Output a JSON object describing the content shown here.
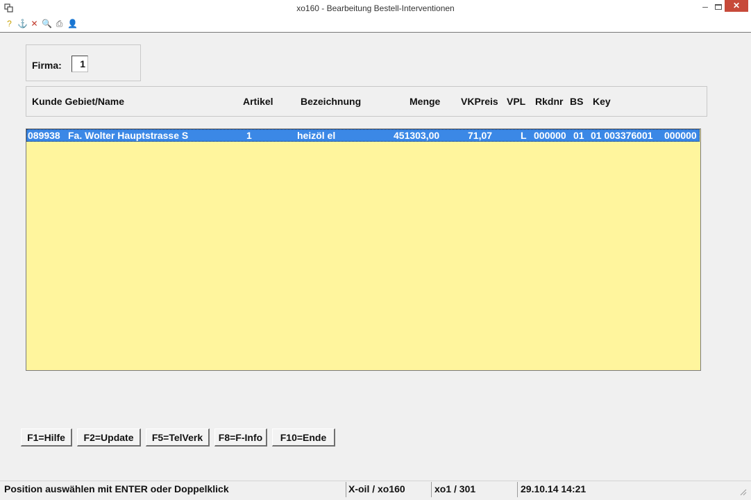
{
  "window": {
    "title": "xo160 - Bearbeitung Bestell-Interventionen",
    "min_glyph": "–",
    "close_glyph": "✕"
  },
  "toolbar": {
    "icons": [
      {
        "name": "help-icon",
        "glyph": "?",
        "color": "#c9a200"
      },
      {
        "name": "anchor-icon",
        "glyph": "⚓",
        "color": "#2a6fcf"
      },
      {
        "name": "delete-icon",
        "glyph": "✕",
        "color": "#c0392b"
      },
      {
        "name": "search-icon",
        "glyph": "🔍",
        "color": "#666666"
      },
      {
        "name": "print-icon",
        "glyph": "⎙",
        "color": "#555555"
      },
      {
        "name": "user-icon",
        "glyph": "👤",
        "color": "#b45a1f"
      }
    ]
  },
  "firma": {
    "label": "Firma:",
    "value": "1"
  },
  "list_headers": {
    "kunde": "Kunde Gebiet/Name",
    "artikel": "Artikel",
    "bezeichnung": "Bezeichnung",
    "menge": "Menge",
    "vkpreis": "VKPreis",
    "vpl": "VPL",
    "rkdnr": "Rkdnr",
    "bs": "BS",
    "key": "Key"
  },
  "rows": [
    {
      "kunde_nr": "089938",
      "name": "Fa. Wolter Hauptstrasse S",
      "artikel": "1",
      "bezeichnung": "heizöl el",
      "menge": "451303,00",
      "vkpreis": "71,07",
      "vpl": "L",
      "rkdnr": "000000",
      "bs": "01",
      "key": "01 003376001",
      "extra": "000000"
    }
  ],
  "fkeys": [
    "F1=Hilfe",
    "F2=Update",
    "F5=TelVerk",
    "F8=F-Info",
    "F10=Ende"
  ],
  "status": {
    "message": "Position auswählen mit ENTER oder Doppelklick",
    "program": "X-oil / xo160",
    "user": "xo1 / 301",
    "datetime": "29.10.14 14:21"
  },
  "colors": {
    "list_bg": "#fff59d",
    "selection": "#3b88e6",
    "close_btn": "#c74a3a"
  }
}
